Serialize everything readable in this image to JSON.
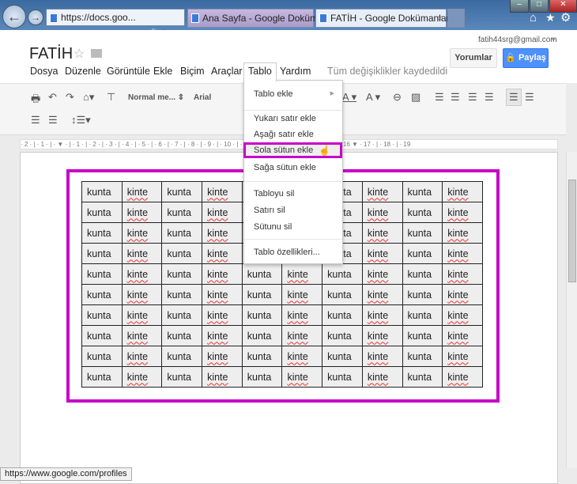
{
  "browser": {
    "address": "https://docs.goo...",
    "tabs": [
      {
        "label": "Ana Sayfa - Google Dokümanlar",
        "active": false
      },
      {
        "label": "FATİH - Google Dokümanlar",
        "active": true
      }
    ],
    "close_tab": "×"
  },
  "account": {
    "email": "fatih44srg@gmail.com"
  },
  "doc": {
    "title": "FATİH"
  },
  "buttons": {
    "comments": "Yorumlar",
    "share": "Paylaş"
  },
  "menu": [
    "Dosya",
    "Düzenle",
    "Görüntüle",
    "Ekle",
    "Biçim",
    "Araçlar",
    "Tablo",
    "Yardım"
  ],
  "save_status": "Tüm değişiklikler kaydedildi",
  "toolbar": {
    "style": "Normal me...",
    "font": "Arial"
  },
  "ruler": "· 2 · | · 1 · | · ▼ · | · 1 · | · 2 · | · 3 · | · 4 · | · 5 · | · 6 · | · 7 · | · 8 · | · 9 · | · 10 · | · 11 · | · 12 · | · 13 · | · 14 · | · 15 · | · 16 ▼ · 17 · | · 18 · | · 19",
  "table_menu": {
    "items": [
      "Tablo ekle",
      "Yukarı satır ekle",
      "Aşağı satır ekle",
      "Sola sütun ekle",
      "Sağa sütun ekle",
      "Tabloyu sil",
      "Satırı sil",
      "Sütunu sil",
      "Tablo özellikleri..."
    ],
    "highlighted": "Sola sütun ekle"
  },
  "table": {
    "rows": 10,
    "cells": [
      "kunta",
      "kinte",
      "kunta",
      "kinte",
      "kunta",
      "kinte",
      "kunta",
      "kinte",
      "kunta",
      "kinte"
    ]
  },
  "status_url": "https://www.google.com/profiles",
  "colors": {
    "highlight": "#c800c8",
    "share": "#4d90fe"
  }
}
